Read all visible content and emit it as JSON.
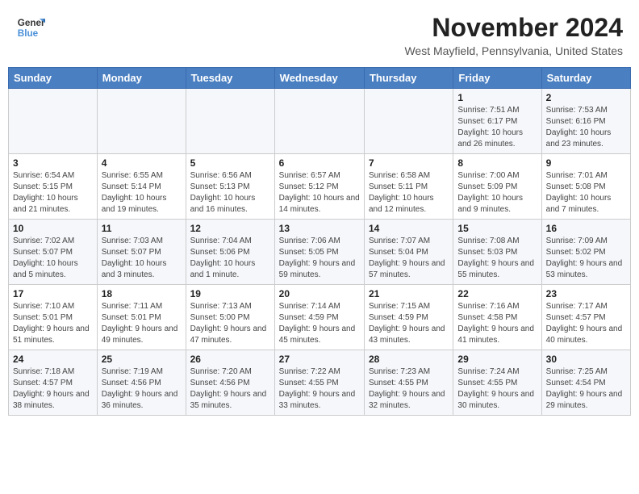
{
  "logo": {
    "line1": "General",
    "line2": "Blue"
  },
  "title": "November 2024",
  "location": "West Mayfield, Pennsylvania, United States",
  "weekdays": [
    "Sunday",
    "Monday",
    "Tuesday",
    "Wednesday",
    "Thursday",
    "Friday",
    "Saturday"
  ],
  "weeks": [
    [
      {
        "day": "",
        "info": ""
      },
      {
        "day": "",
        "info": ""
      },
      {
        "day": "",
        "info": ""
      },
      {
        "day": "",
        "info": ""
      },
      {
        "day": "",
        "info": ""
      },
      {
        "day": "1",
        "info": "Sunrise: 7:51 AM\nSunset: 6:17 PM\nDaylight: 10 hours and 26 minutes."
      },
      {
        "day": "2",
        "info": "Sunrise: 7:53 AM\nSunset: 6:16 PM\nDaylight: 10 hours and 23 minutes."
      }
    ],
    [
      {
        "day": "3",
        "info": "Sunrise: 6:54 AM\nSunset: 5:15 PM\nDaylight: 10 hours and 21 minutes."
      },
      {
        "day": "4",
        "info": "Sunrise: 6:55 AM\nSunset: 5:14 PM\nDaylight: 10 hours and 19 minutes."
      },
      {
        "day": "5",
        "info": "Sunrise: 6:56 AM\nSunset: 5:13 PM\nDaylight: 10 hours and 16 minutes."
      },
      {
        "day": "6",
        "info": "Sunrise: 6:57 AM\nSunset: 5:12 PM\nDaylight: 10 hours and 14 minutes."
      },
      {
        "day": "7",
        "info": "Sunrise: 6:58 AM\nSunset: 5:11 PM\nDaylight: 10 hours and 12 minutes."
      },
      {
        "day": "8",
        "info": "Sunrise: 7:00 AM\nSunset: 5:09 PM\nDaylight: 10 hours and 9 minutes."
      },
      {
        "day": "9",
        "info": "Sunrise: 7:01 AM\nSunset: 5:08 PM\nDaylight: 10 hours and 7 minutes."
      }
    ],
    [
      {
        "day": "10",
        "info": "Sunrise: 7:02 AM\nSunset: 5:07 PM\nDaylight: 10 hours and 5 minutes."
      },
      {
        "day": "11",
        "info": "Sunrise: 7:03 AM\nSunset: 5:07 PM\nDaylight: 10 hours and 3 minutes."
      },
      {
        "day": "12",
        "info": "Sunrise: 7:04 AM\nSunset: 5:06 PM\nDaylight: 10 hours and 1 minute."
      },
      {
        "day": "13",
        "info": "Sunrise: 7:06 AM\nSunset: 5:05 PM\nDaylight: 9 hours and 59 minutes."
      },
      {
        "day": "14",
        "info": "Sunrise: 7:07 AM\nSunset: 5:04 PM\nDaylight: 9 hours and 57 minutes."
      },
      {
        "day": "15",
        "info": "Sunrise: 7:08 AM\nSunset: 5:03 PM\nDaylight: 9 hours and 55 minutes."
      },
      {
        "day": "16",
        "info": "Sunrise: 7:09 AM\nSunset: 5:02 PM\nDaylight: 9 hours and 53 minutes."
      }
    ],
    [
      {
        "day": "17",
        "info": "Sunrise: 7:10 AM\nSunset: 5:01 PM\nDaylight: 9 hours and 51 minutes."
      },
      {
        "day": "18",
        "info": "Sunrise: 7:11 AM\nSunset: 5:01 PM\nDaylight: 9 hours and 49 minutes."
      },
      {
        "day": "19",
        "info": "Sunrise: 7:13 AM\nSunset: 5:00 PM\nDaylight: 9 hours and 47 minutes."
      },
      {
        "day": "20",
        "info": "Sunrise: 7:14 AM\nSunset: 4:59 PM\nDaylight: 9 hours and 45 minutes."
      },
      {
        "day": "21",
        "info": "Sunrise: 7:15 AM\nSunset: 4:59 PM\nDaylight: 9 hours and 43 minutes."
      },
      {
        "day": "22",
        "info": "Sunrise: 7:16 AM\nSunset: 4:58 PM\nDaylight: 9 hours and 41 minutes."
      },
      {
        "day": "23",
        "info": "Sunrise: 7:17 AM\nSunset: 4:57 PM\nDaylight: 9 hours and 40 minutes."
      }
    ],
    [
      {
        "day": "24",
        "info": "Sunrise: 7:18 AM\nSunset: 4:57 PM\nDaylight: 9 hours and 38 minutes."
      },
      {
        "day": "25",
        "info": "Sunrise: 7:19 AM\nSunset: 4:56 PM\nDaylight: 9 hours and 36 minutes."
      },
      {
        "day": "26",
        "info": "Sunrise: 7:20 AM\nSunset: 4:56 PM\nDaylight: 9 hours and 35 minutes."
      },
      {
        "day": "27",
        "info": "Sunrise: 7:22 AM\nSunset: 4:55 PM\nDaylight: 9 hours and 33 minutes."
      },
      {
        "day": "28",
        "info": "Sunrise: 7:23 AM\nSunset: 4:55 PM\nDaylight: 9 hours and 32 minutes."
      },
      {
        "day": "29",
        "info": "Sunrise: 7:24 AM\nSunset: 4:55 PM\nDaylight: 9 hours and 30 minutes."
      },
      {
        "day": "30",
        "info": "Sunrise: 7:25 AM\nSunset: 4:54 PM\nDaylight: 9 hours and 29 minutes."
      }
    ]
  ],
  "colors": {
    "header_bg": "#4a7fc1",
    "header_text": "#ffffff",
    "odd_row_bg": "#f5f7fa",
    "even_row_bg": "#ffffff"
  }
}
